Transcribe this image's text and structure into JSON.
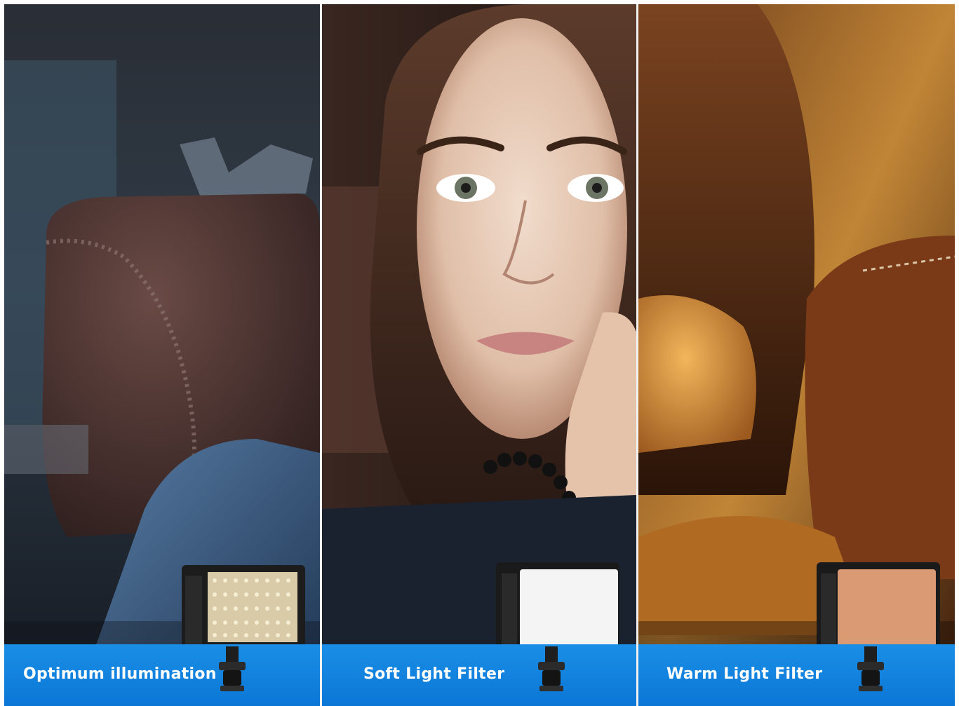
{
  "panels": [
    {
      "caption": "Optimum illumination",
      "filter": "none",
      "light_face": "LED array"
    },
    {
      "caption": "Soft Light Filter",
      "filter": "soft",
      "light_face": "white diffuser"
    },
    {
      "caption": "Warm Light Filter",
      "filter": "warm",
      "light_face": "orange diffuser"
    }
  ],
  "colors": {
    "caption_bar": "#0b76d6",
    "caption_text": "#ffffff",
    "panel1_tone": "#2c3a4a",
    "panel2_tone": "#4a3028",
    "panel3_tone": "#b8772a"
  }
}
